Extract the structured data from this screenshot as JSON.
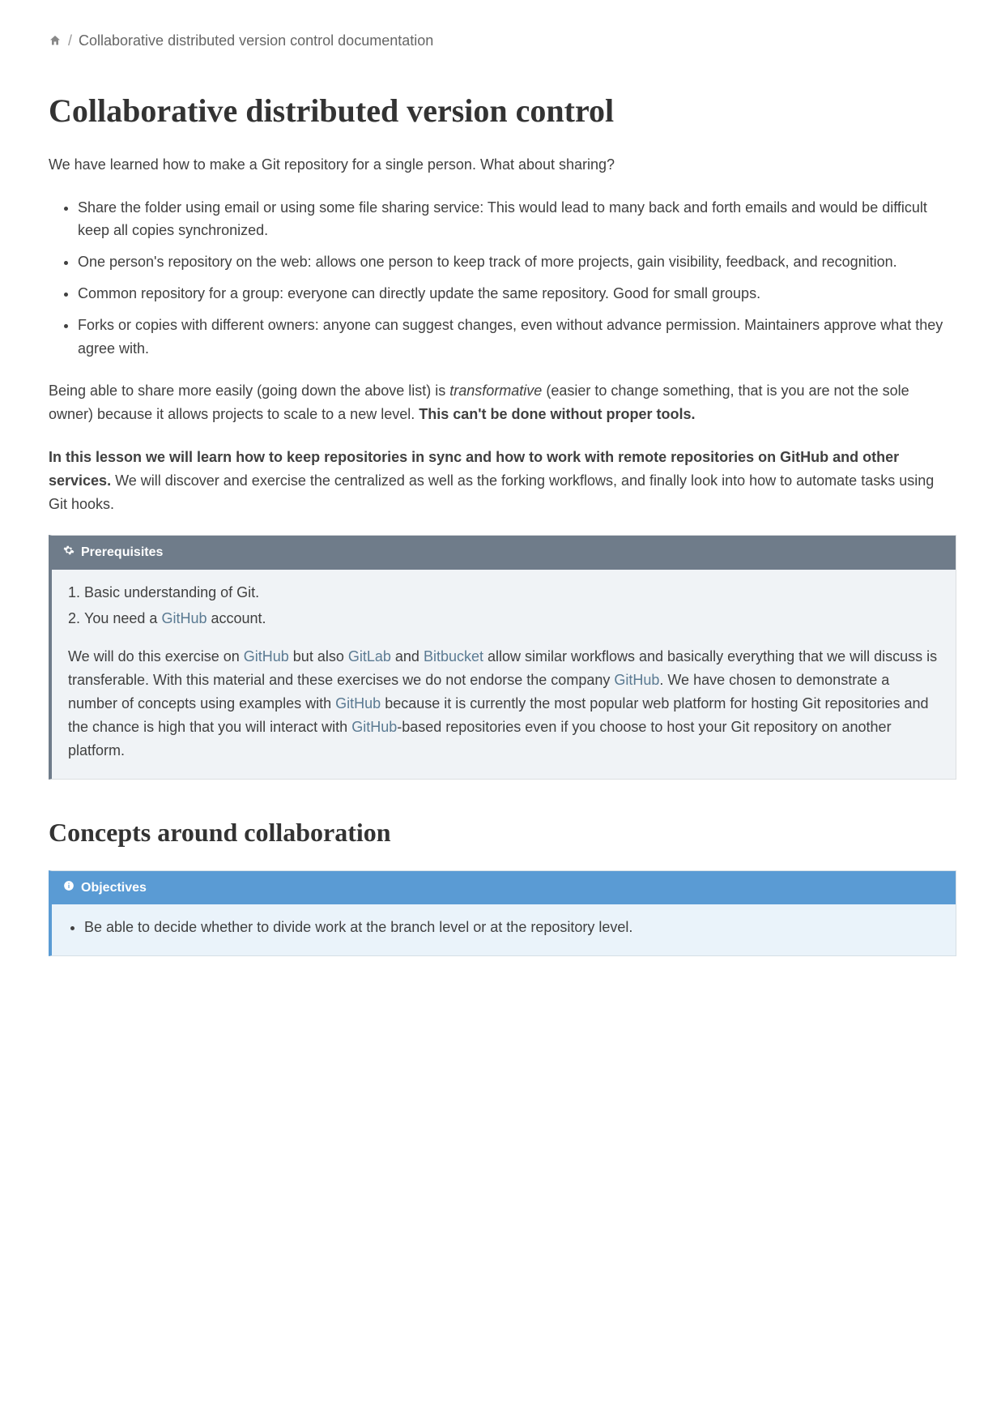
{
  "breadcrumb": {
    "current": "Collaborative distributed version control documentation"
  },
  "title": "Collaborative distributed version control",
  "intro": "We have learned how to make a Git repository for a single person. What about sharing?",
  "bullets": [
    "Share the folder using email or using some file sharing service: This would lead to many back and forth emails and would be difficult keep all copies synchronized.",
    "One person's repository on the web: allows one person to keep track of more projects, gain visibility, feedback, and recognition.",
    "Common repository for a group: everyone can directly update the same repository. Good for small groups.",
    "Forks or copies with different owners: anyone can suggest changes, even without advance permission. Maintainers approve what they agree with."
  ],
  "para2_a": "Being able to share more easily (going down the above list) is ",
  "para2_em": "transformative",
  "para2_b": " (easier to change something, that is you are not the sole owner) because it allows projects to scale to a new level. ",
  "para2_strong": "This can't be done without proper tools.",
  "para3_strong": "In this lesson we will learn how to keep repositories in sync and how to work with remote repositories on GitHub and other services.",
  "para3_rest": " We will discover and exercise the centralized as well as the forking workflows, and finally look into how to automate tasks using Git hooks.",
  "prereq": {
    "title": "Prerequisites",
    "items": {
      "i1": "Basic understanding of Git.",
      "i2a": "You need a ",
      "i2link": "GitHub",
      "i2b": " account."
    },
    "p_a": "We will do this exercise on ",
    "p_l1": "GitHub",
    "p_b": " but also ",
    "p_l2": "GitLab",
    "p_c": " and ",
    "p_l3": "Bitbucket",
    "p_d": " allow similar workflows and basically everything that we will discuss is transferable. With this material and these exercises we do not endorse the company ",
    "p_l4": "GitHub",
    "p_e": ". We have chosen to demonstrate a number of concepts using examples with ",
    "p_l5": "GitHub",
    "p_f": " because it is currently the most popular web platform for hosting Git repositories and the chance is high that you will interact with ",
    "p_l6": "GitHub",
    "p_g": "-based repositories even if you choose to host your Git repository on another platform."
  },
  "concepts_heading": "Concepts around collaboration",
  "objectives": {
    "title": "Objectives",
    "items": {
      "o1": "Be able to decide whether to divide work at the branch level or at the repository level."
    }
  }
}
